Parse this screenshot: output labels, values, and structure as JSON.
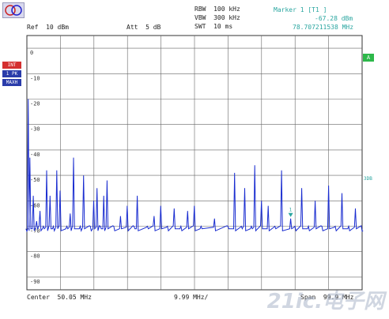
{
  "header": {
    "rbw_label": "RBW",
    "rbw_value": "100 kHz",
    "vbw_label": "VBW",
    "vbw_value": "300 kHz",
    "swt_label": "SWT",
    "swt_value": "10 ms",
    "ref_label": "Ref",
    "ref_value": "10 dBm",
    "att_label": "Att",
    "att_value": "5 dB",
    "marker_title": "Marker 1 [T1 ]",
    "marker_level": "-67.28 dBm",
    "marker_freq": "78.707211538 MHz"
  },
  "side_tags": {
    "trg": "INT TRG",
    "trace": "1 PK",
    "mode": "MAXH",
    "green": "A",
    "right_label": "3DB"
  },
  "footer": {
    "center_label": "Center",
    "center_value": "50.05 MHz",
    "div_value": "9.99 MHz/",
    "span_label": "Span",
    "span_value": "99.9 MHz"
  },
  "watermark": "21ic.电子网",
  "chart_data": {
    "type": "line",
    "ylabel": "dBm",
    "yticks": [
      "0",
      "-10",
      "-20",
      "-30",
      "-40",
      "-50",
      "-60",
      "-70",
      "-80",
      "-90"
    ],
    "ylim": [
      -95,
      5
    ],
    "xlim": [
      0.1,
      100.0
    ],
    "grid": true,
    "noise_floor_dbm": -71,
    "series": [
      {
        "x": [
          0.1,
          0.5,
          1.0,
          2.0,
          3.0,
          4.0,
          5.0,
          6.0,
          7.0,
          8.0,
          9.0,
          10.0,
          12.0,
          13.0,
          14.0,
          16.0,
          17.0,
          19.0,
          20.0,
          21.0,
          22.0,
          23.0,
          24.0,
          26.0,
          28.0,
          30.0,
          32.0,
          33.0,
          36.0,
          38.0,
          40.0,
          42.0,
          44.0,
          46.0,
          48.0,
          50.0,
          52.0,
          56.0,
          60.0,
          62.0,
          64.0,
          65.0,
          67.0,
          68.0,
          70.0,
          72.0,
          74.0,
          76.0,
          78.7,
          80.0,
          82.0,
          84.0,
          86.0,
          88.0,
          90.0,
          92.0,
          94.0,
          96.0,
          98.0,
          100.0
        ],
        "values": [
          -72,
          -20,
          -43,
          -58,
          -68,
          -64,
          -70,
          -48,
          -58,
          -70,
          -48,
          -56,
          -70,
          -65,
          -43,
          -70,
          -50,
          -70,
          -60,
          -55,
          -70,
          -58,
          -52,
          -70,
          -66,
          -62,
          -70,
          -58,
          -70,
          -66,
          -62,
          -70,
          -63,
          -70,
          -64,
          -62,
          -70,
          -67,
          -70,
          -49,
          -70,
          -55,
          -70,
          -46,
          -60,
          -62,
          -70,
          -48,
          -67,
          -70,
          -55,
          -70,
          -60,
          -70,
          -54,
          -70,
          -57,
          -70,
          -63,
          -72
        ]
      }
    ],
    "marker": {
      "x": 78.707211538,
      "y": -67.28,
      "label": "1"
    }
  }
}
